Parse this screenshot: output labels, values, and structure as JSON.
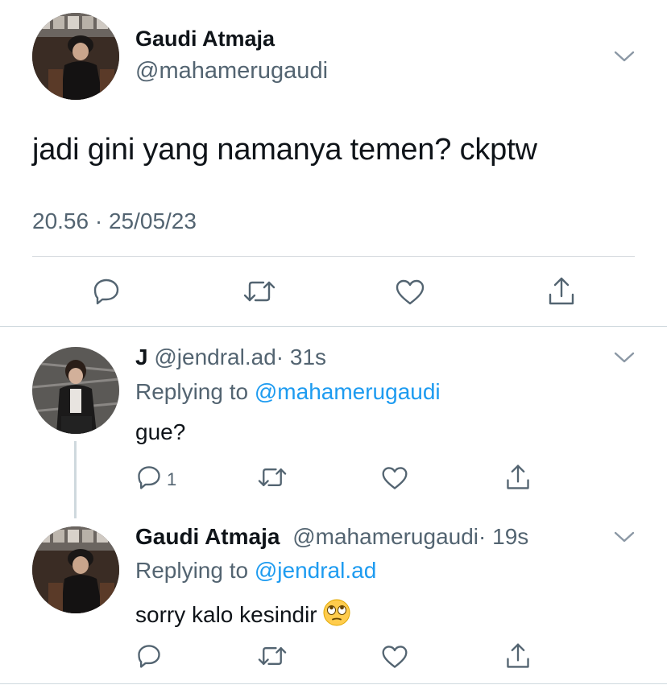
{
  "main_tweet": {
    "display_name": "Gaudi Atmaja",
    "handle": "@mahamerugaudi",
    "text": "jadi gini yang namanya temen? ckptw",
    "timestamp": "20.56 · 25/05/23"
  },
  "replies": [
    {
      "display_name": "J",
      "handle": "@jendral.ad",
      "time": "· 31s",
      "replying_prefix": "Replying to",
      "replying_to": "@mahamerugaudi",
      "text": "gue?",
      "reply_count": "1"
    },
    {
      "display_name": "Gaudi Atmaja",
      "handle": "@mahamerugaudi",
      "time": "· 19s",
      "replying_prefix": "Replying to",
      "replying_to": "@jendral.ad",
      "text": "sorry kalo kesindir",
      "emoji": "face-with-rolling-eyes"
    }
  ],
  "colors": {
    "text": "#0f1419",
    "secondary": "#536471",
    "link": "#1d9bf0",
    "divider": "#d7dbdf"
  }
}
